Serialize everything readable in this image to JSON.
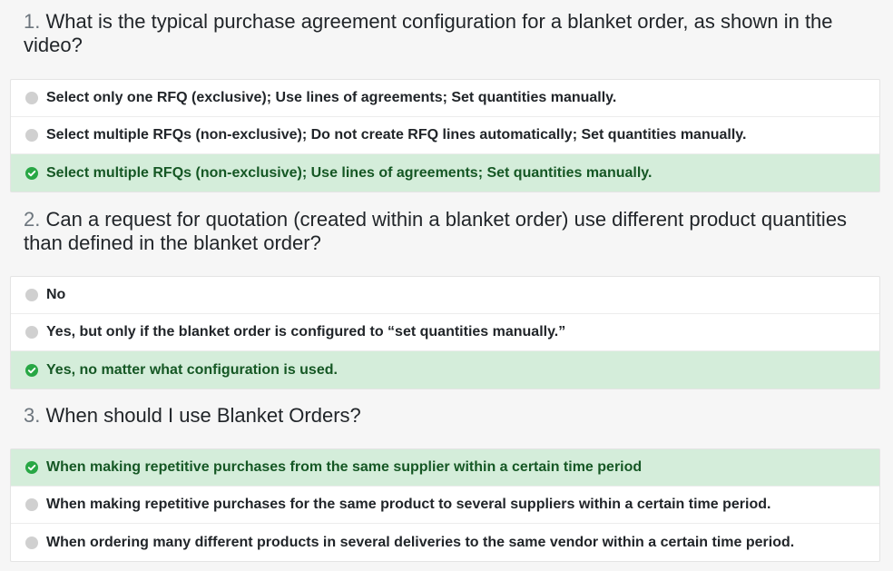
{
  "questions": [
    {
      "number": "1.",
      "text": "What is the typical purchase agreement configuration for a blanket order, as shown in the video?",
      "answers": [
        {
          "label": "Select only one RFQ (exclusive); Use lines of agreements; Set quantities manually.",
          "correct": false
        },
        {
          "label": "Select multiple RFQs (non-exclusive); Do not create RFQ lines automatically; Set quantities manually.",
          "correct": false
        },
        {
          "label": "Select multiple RFQs (non-exclusive); Use lines of agreements; Set quantities manually.",
          "correct": true
        }
      ]
    },
    {
      "number": "2.",
      "text": "Can a request for quotation (created within a blanket order) use different product quantities than defined in the blanket order?",
      "answers": [
        {
          "label": "No",
          "correct": false
        },
        {
          "label": "Yes, but only if the blanket order is configured to “set quantities manually.”",
          "correct": false
        },
        {
          "label": "Yes, no matter what configuration is used.",
          "correct": true
        }
      ]
    },
    {
      "number": "3.",
      "text": "When should I use Blanket Orders?",
      "answers": [
        {
          "label": "When making repetitive purchases from the same supplier within a certain time period",
          "correct": true
        },
        {
          "label": "When making repetitive purchases for the same product to several suppliers within a certain time period.",
          "correct": false
        },
        {
          "label": "When ordering many different products in several deliveries to the same vendor within a certain time period.",
          "correct": false
        }
      ]
    }
  ],
  "colors": {
    "correct_bg": "#d4edda",
    "correct_text": "#155724",
    "check_icon": "#28a745",
    "radio_dot": "#d0d0d0"
  },
  "icons": {
    "correct": "check-circle-icon",
    "unselected": "radio-dot-icon"
  }
}
